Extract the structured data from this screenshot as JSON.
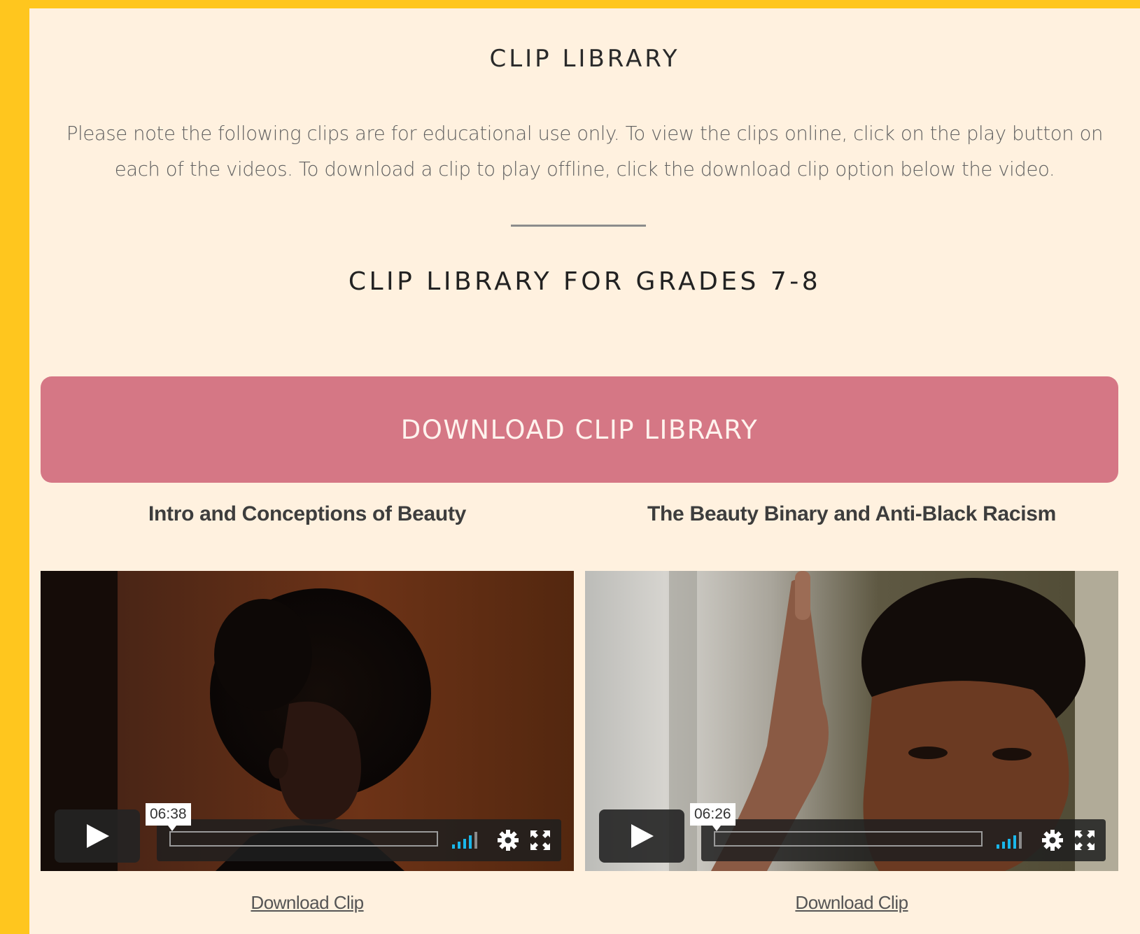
{
  "page": {
    "title": "CLIP LIBRARY",
    "intro": "Please note the following clips are for educational use only. To view the clips online, click on the play button on each of the videos. To download a clip to play offline, click the download clip option below the video.",
    "section_title": "CLIP LIBRARY FOR GRADES 7-8",
    "download_library_label": "DOWNLOAD CLIP LIBRARY"
  },
  "clips": [
    {
      "title": "Intro and Conceptions of Beauty",
      "duration": "06:38",
      "download_label": "Download Clip"
    },
    {
      "title": "The Beauty Binary and Anti-Black Racism",
      "duration": "06:26",
      "download_label": "Download Clip"
    }
  ],
  "icons": {
    "play": "play-icon",
    "volume": "volume-icon",
    "settings": "gear-icon",
    "fullscreen": "fullscreen-icon"
  },
  "colors": {
    "outer_background": "#FFC61E",
    "panel_background": "#FFF1DF",
    "download_button": "#D57785",
    "volume_accent": "#1ab7ea"
  }
}
